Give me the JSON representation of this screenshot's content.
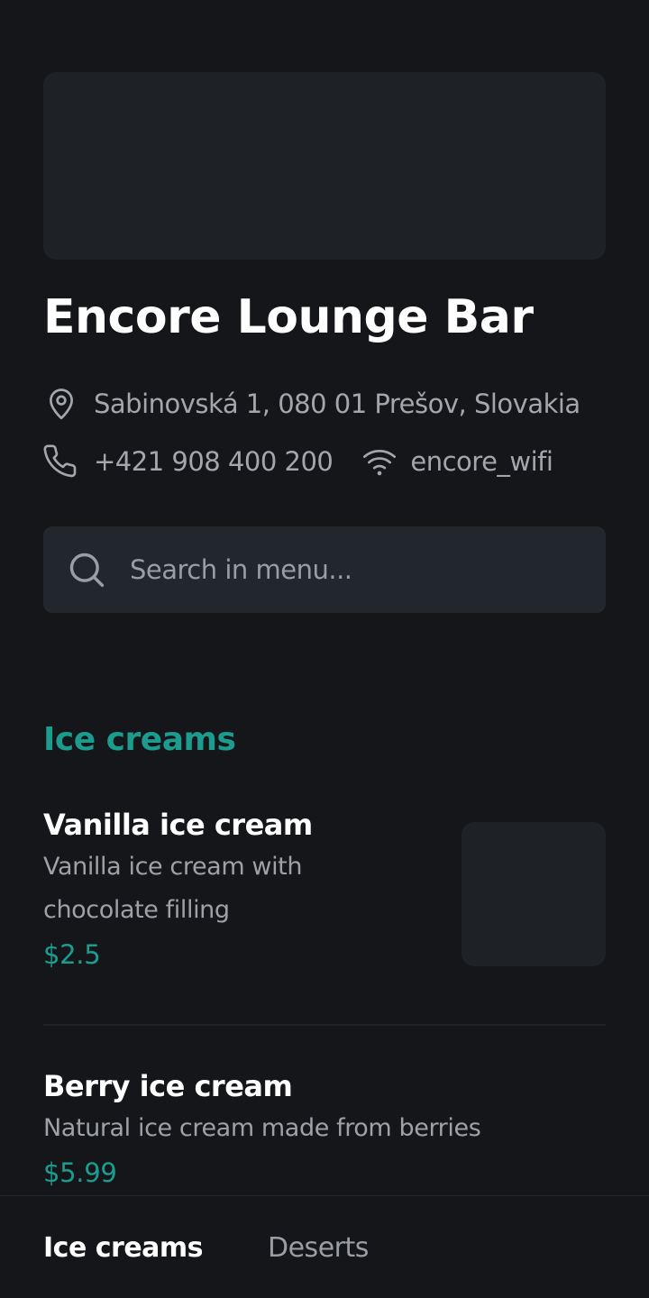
{
  "venue": {
    "name": "Encore Lounge Bar",
    "address": "Sabinovská 1, 080 01 Prešov, Slovakia",
    "phone": "+421 908 400 200",
    "wifi": "encore_wifi"
  },
  "search": {
    "placeholder": "Search in menu..."
  },
  "menu": {
    "section_title": "Ice creams",
    "items": [
      {
        "name": "Vanilla ice cream",
        "description": "Vanilla ice cream with chocolate filling",
        "price": "$2.5"
      },
      {
        "name": "Berry ice cream",
        "description": "Natural ice cream made from berries",
        "price": "$5.99"
      }
    ]
  },
  "bottom_nav": {
    "tabs": [
      {
        "label": "Ice creams",
        "active": true
      },
      {
        "label": "Deserts",
        "active": false
      }
    ]
  },
  "colors": {
    "background": "#15161a",
    "accent": "#1c9c8e",
    "muted_text": "#9ea1a6",
    "surface": "#22262d"
  },
  "icons": {
    "address": "location-pin-icon",
    "phone": "phone-icon",
    "wifi": "wifi-icon",
    "search": "search-icon"
  }
}
